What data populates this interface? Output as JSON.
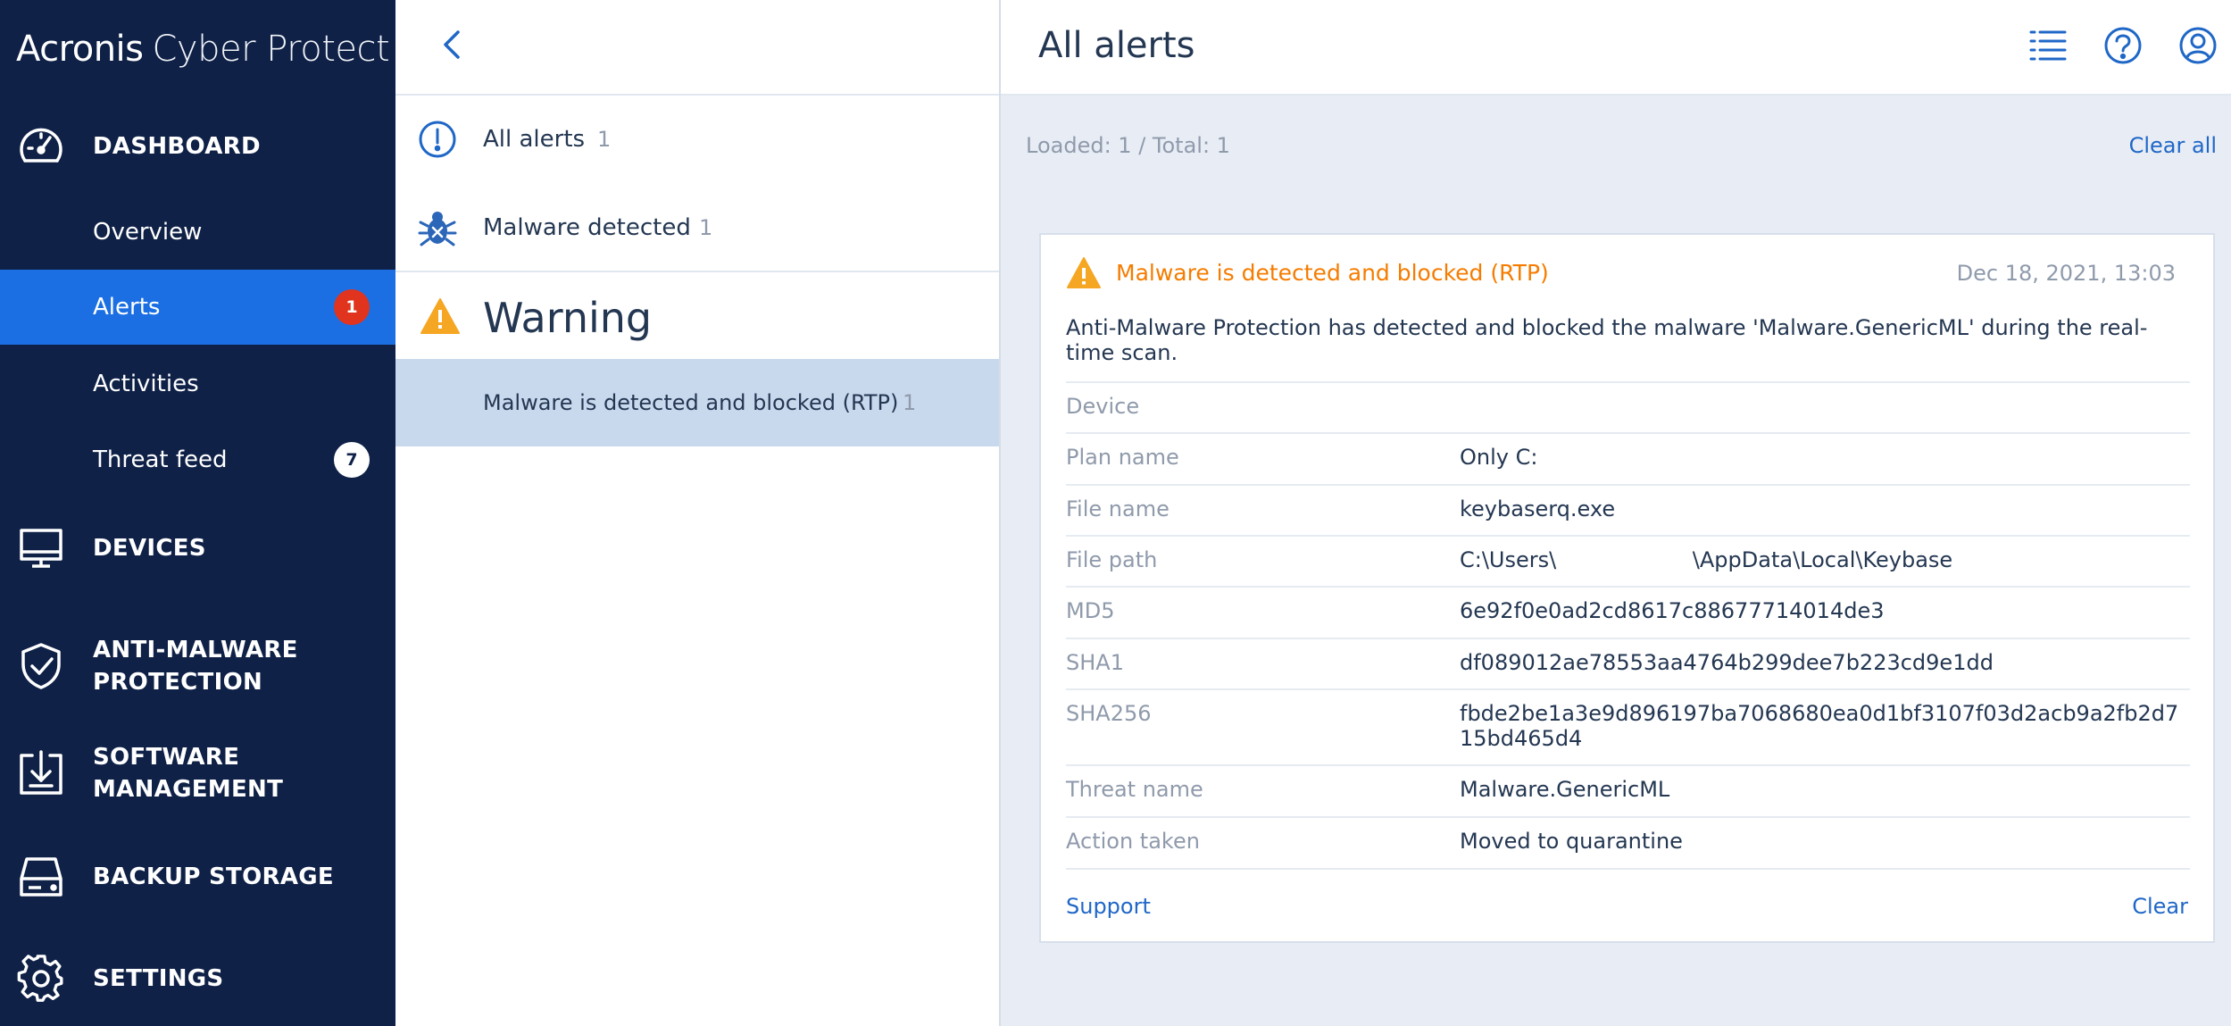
{
  "app": {
    "brand": "Acronis",
    "product": "Cyber Protect"
  },
  "sidebar": {
    "sections": [
      {
        "label": "DASHBOARD",
        "icon": "dashboard-icon"
      },
      {
        "label": "DEVICES",
        "icon": "monitor-icon"
      },
      {
        "label": "ANTI-MALWARE PROTECTION",
        "line1": "ANTI-MALWARE",
        "line2": "PROTECTION",
        "icon": "shield-check-icon"
      },
      {
        "label": "SOFTWARE MANAGEMENT",
        "line1": "SOFTWARE",
        "line2": "MANAGEMENT",
        "icon": "software-download-icon"
      },
      {
        "label": "BACKUP STORAGE",
        "icon": "storage-drive-icon"
      },
      {
        "label": "SETTINGS",
        "icon": "gear-icon"
      }
    ],
    "dashboard_items": [
      {
        "label": "Overview"
      },
      {
        "label": "Alerts",
        "badge": "1",
        "active": true
      },
      {
        "label": "Activities"
      },
      {
        "label": "Threat feed",
        "badge": "7"
      }
    ]
  },
  "alert_categories": {
    "all": {
      "label": "All alerts",
      "count": "1",
      "icon": "exclamation-circle-icon"
    },
    "malware": {
      "label": "Malware detected",
      "count": "1",
      "icon": "bug-icon"
    },
    "group_heading": "Warning",
    "group_icon": "warning-triangle-icon",
    "selected": {
      "label": "Malware is detected and blocked (RTP)",
      "count": "1"
    }
  },
  "header": {
    "title": "All alerts",
    "icons": [
      "list-icon",
      "help-icon",
      "account-icon"
    ]
  },
  "toolbar": {
    "loaded_text": "Loaded: 1 / Total: 1",
    "clear_all": "Clear all"
  },
  "alert_card": {
    "title": "Malware is detected and blocked (RTP)",
    "date": "Dec 18, 2021, 13:03",
    "description": "Anti-Malware Protection has detected and blocked the malware 'Malware.GenericML' during the real-time scan.",
    "details": [
      {
        "key": "Device",
        "value": ""
      },
      {
        "key": "Plan name",
        "value": "Only C:"
      },
      {
        "key": "File name",
        "value": "keybaserq.exe"
      },
      {
        "key": "File path",
        "value": "C:\\Users\\                    \\AppData\\Local\\Keybase"
      },
      {
        "key": "MD5",
        "value": "6e92f0e0ad2cd8617c88677714014de3"
      },
      {
        "key": "SHA1",
        "value": "df089012ae78553aa4764b299dee7b223cd9e1dd"
      },
      {
        "key": "SHA256",
        "value": "fbde2be1a3e9d896197ba7068680ea0d1bf3107f03d2acb9a2fb2d715bd465d4"
      },
      {
        "key": "Threat name",
        "value": "Malware.GenericML"
      },
      {
        "key": "Action taken",
        "value": "Moved to quarantine"
      }
    ],
    "support_link": "Support",
    "clear_link": "Clear"
  },
  "colors": {
    "sidebar_bg": "#0f2147",
    "active_item": "#1b6fe3",
    "link": "#1f67c7",
    "warning": "#f57c00",
    "badge_red": "#e0341f"
  }
}
